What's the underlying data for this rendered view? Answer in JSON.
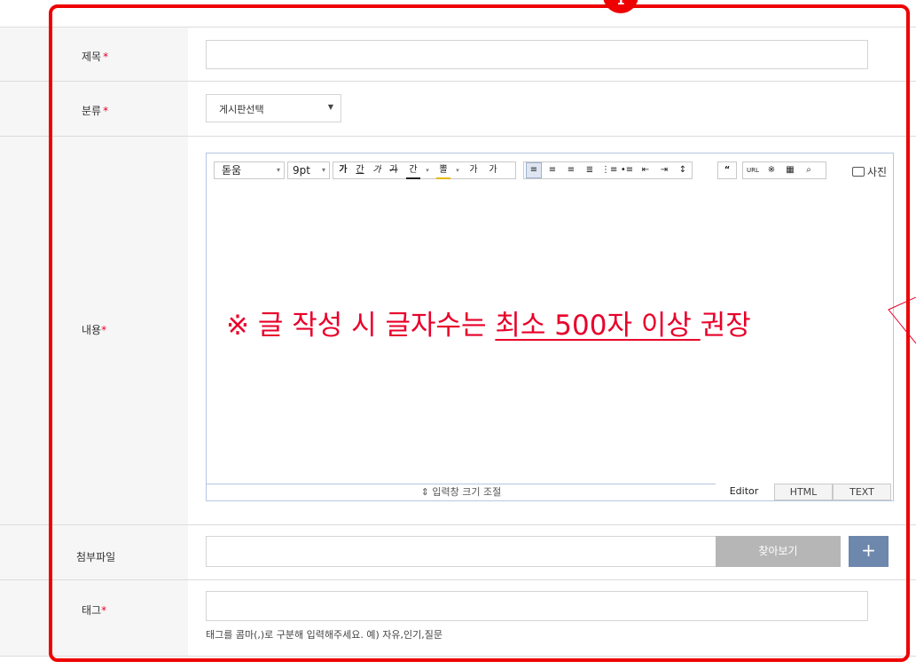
{
  "form": {
    "title": {
      "label": "제목",
      "required_mark": "*",
      "value": ""
    },
    "category": {
      "label": "분류",
      "required_mark": "*",
      "selected": "게시판선택"
    },
    "content": {
      "label": "내용",
      "required_mark": "*"
    },
    "attachment": {
      "label": "첨부파일",
      "value": "",
      "browse_label": "찾아보기",
      "add_label": "+"
    },
    "tags": {
      "label": "태그",
      "required_mark": "*",
      "value": "",
      "hint": "태그를 콤마(,)로 구분해 입력해주세요. 예) 자유,인기,질문"
    }
  },
  "editor": {
    "font": "돋움",
    "size": "9pt",
    "toolbar_glyphs": [
      "가",
      "간",
      "가",
      "가",
      "간",
      "뽈",
      "가",
      "가"
    ],
    "photo_label": "사진",
    "notice": {
      "before": "※ 글 작성 시 글자수는 ",
      "underlined": "최소 500자 이상 ",
      "after": "권장"
    },
    "resize_label": "⇕ 입력창 크기 조절",
    "modes": [
      {
        "label": "Editor",
        "active": true
      },
      {
        "label": "HTML",
        "active": false
      },
      {
        "label": "TEXT",
        "active": false
      }
    ]
  },
  "annotation": {
    "badge": "1",
    "color": "#ee0000"
  },
  "colors": {
    "required": "#e8002a",
    "label_bg": "#f6f6f6",
    "browse_bg": "#b6b6b6",
    "add_bg": "#6d87ad"
  }
}
